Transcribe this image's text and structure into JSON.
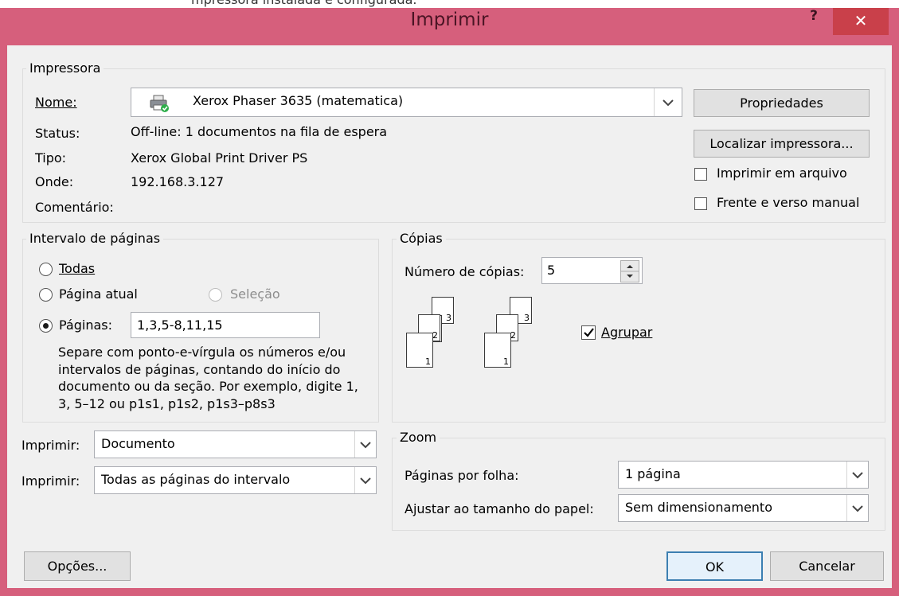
{
  "background_text": "mpressora instalada e configurada.",
  "dialog": {
    "title": "Imprimir",
    "help_label": "?",
    "close_label": "✕"
  },
  "printer": {
    "group_label": "Impressora",
    "name_label": "Nome:",
    "name_value": "Xerox Phaser 3635 (matematica)",
    "status_label": "Status:",
    "status_value": "Off-line: 1 documentos na fila de espera",
    "type_label": "Tipo:",
    "type_value": "Xerox Global Print Driver PS",
    "where_label": "Onde:",
    "where_value": "192.168.3.127",
    "comment_label": "Comentário:",
    "comment_value": "",
    "properties_button": "Propriedades",
    "find_printer_button": "Localizar impressora...",
    "print_to_file_label": "Imprimir em arquivo",
    "print_to_file_checked": false,
    "manual_duplex_label": "Frente e verso manual",
    "manual_duplex_checked": false
  },
  "page_range": {
    "group_label": "Intervalo de páginas",
    "all_label": "Todas",
    "current_label": "Página atual",
    "selection_label": "Seleção",
    "pages_label": "Páginas:",
    "pages_value": "1,3,5-8,11,15",
    "selected_option": "Páginas",
    "help_text": "Separe com ponto-e-vírgula os números e/ou intervalos de páginas, contando do início do documento ou da seção. Por exemplo, digite 1, 3, 5–12 ou p1s1, p1s2, p1s3–p8s3"
  },
  "copies": {
    "group_label": "Cópias",
    "count_label": "Número de cópias:",
    "count_value": "5",
    "collate_label": "Agrupar",
    "collate_checked": true,
    "sheet_numbers": [
      "1",
      "2",
      "3"
    ]
  },
  "print_what": {
    "label": "Imprimir:",
    "value": "Documento"
  },
  "print_scope": {
    "label": "Imprimir:",
    "value": "Todas as páginas do intervalo"
  },
  "zoom": {
    "group_label": "Zoom",
    "pages_per_sheet_label": "Páginas por folha:",
    "pages_per_sheet_value": "1 página",
    "scale_label": "Ajustar ao tamanho do papel:",
    "scale_value": "Sem dimensionamento"
  },
  "footer": {
    "options_button": "Opções...",
    "ok_button": "OK",
    "cancel_button": "Cancelar"
  },
  "colors": {
    "frame": "#d65f7c",
    "close_button": "#c9404a",
    "client": "#f0f0f0",
    "focus_border": "#3c7fb1"
  }
}
